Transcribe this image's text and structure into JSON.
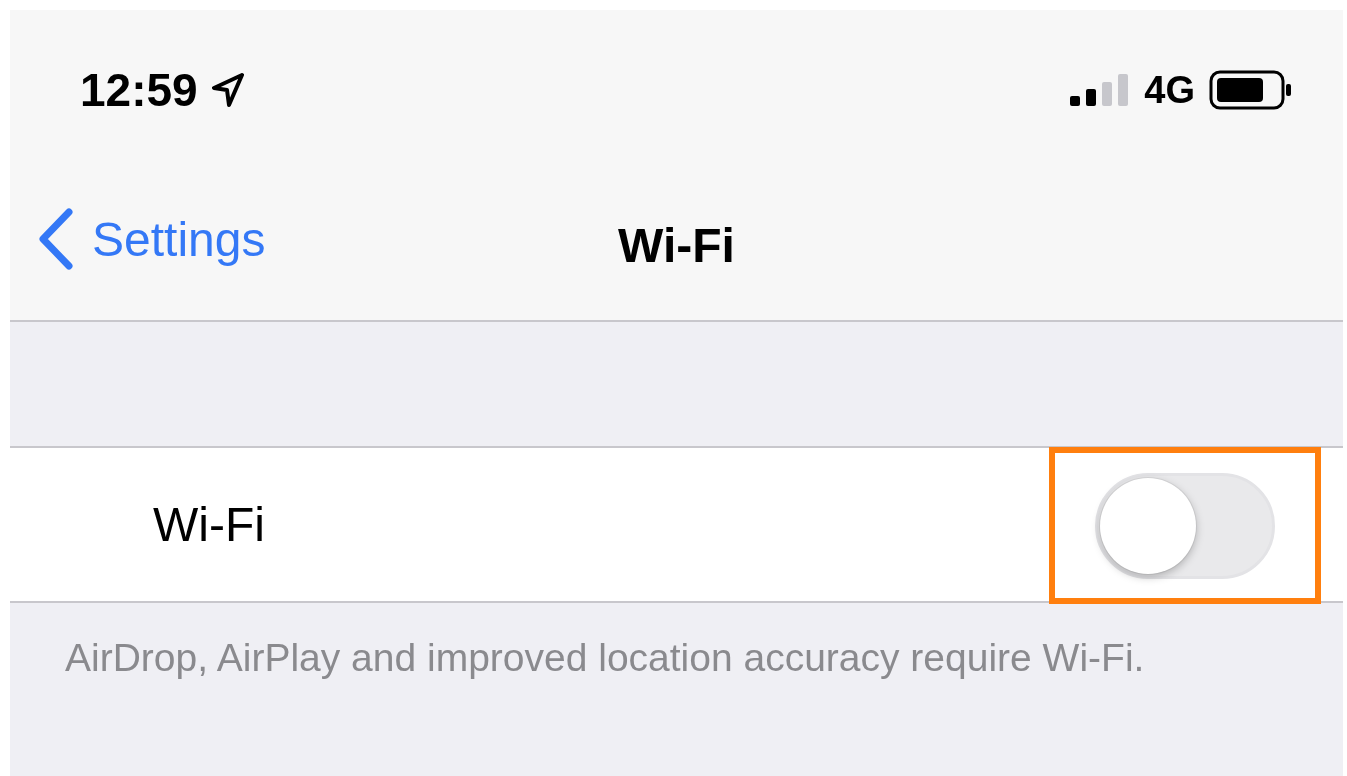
{
  "status_bar": {
    "time": "12:59",
    "network": "4G"
  },
  "nav_bar": {
    "back_label": "Settings",
    "title": "Wi-Fi"
  },
  "settings_rows": [
    {
      "label": "Wi-Fi",
      "on": false,
      "highlighted": true
    }
  ],
  "footer_note": "AirDrop, AirPlay and improved location accuracy require Wi-Fi."
}
